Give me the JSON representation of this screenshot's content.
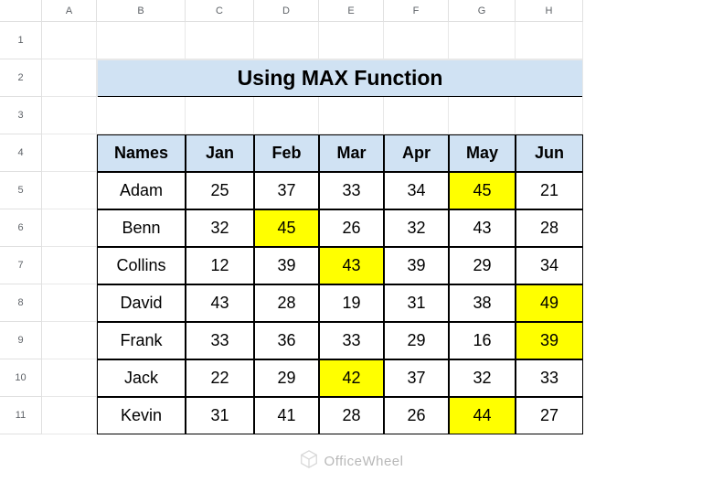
{
  "columns": [
    "A",
    "B",
    "C",
    "D",
    "E",
    "F",
    "G",
    "H"
  ],
  "rows": [
    "1",
    "2",
    "3",
    "4",
    "5",
    "6",
    "7",
    "8",
    "9",
    "10",
    "11"
  ],
  "title": "Using MAX Function",
  "table": {
    "headers": [
      "Names",
      "Jan",
      "Feb",
      "Mar",
      "Apr",
      "May",
      "Jun"
    ],
    "data": [
      {
        "name": "Adam",
        "vals": [
          "25",
          "37",
          "33",
          "34",
          "45",
          "21"
        ],
        "hi": 4
      },
      {
        "name": "Benn",
        "vals": [
          "32",
          "45",
          "26",
          "32",
          "43",
          "28"
        ],
        "hi": 1
      },
      {
        "name": "Collins",
        "vals": [
          "12",
          "39",
          "43",
          "39",
          "29",
          "34"
        ],
        "hi": 2
      },
      {
        "name": "David",
        "vals": [
          "43",
          "28",
          "19",
          "31",
          "38",
          "49"
        ],
        "hi": 5
      },
      {
        "name": "Frank",
        "vals": [
          "33",
          "36",
          "33",
          "29",
          "16",
          "39"
        ],
        "hi": 5
      },
      {
        "name": "Jack",
        "vals": [
          "22",
          "29",
          "42",
          "37",
          "32",
          "33"
        ],
        "hi": 2
      },
      {
        "name": "Kevin",
        "vals": [
          "31",
          "41",
          "28",
          "26",
          "44",
          "27"
        ],
        "hi": 4
      }
    ]
  },
  "watermark": "OfficeWheel"
}
